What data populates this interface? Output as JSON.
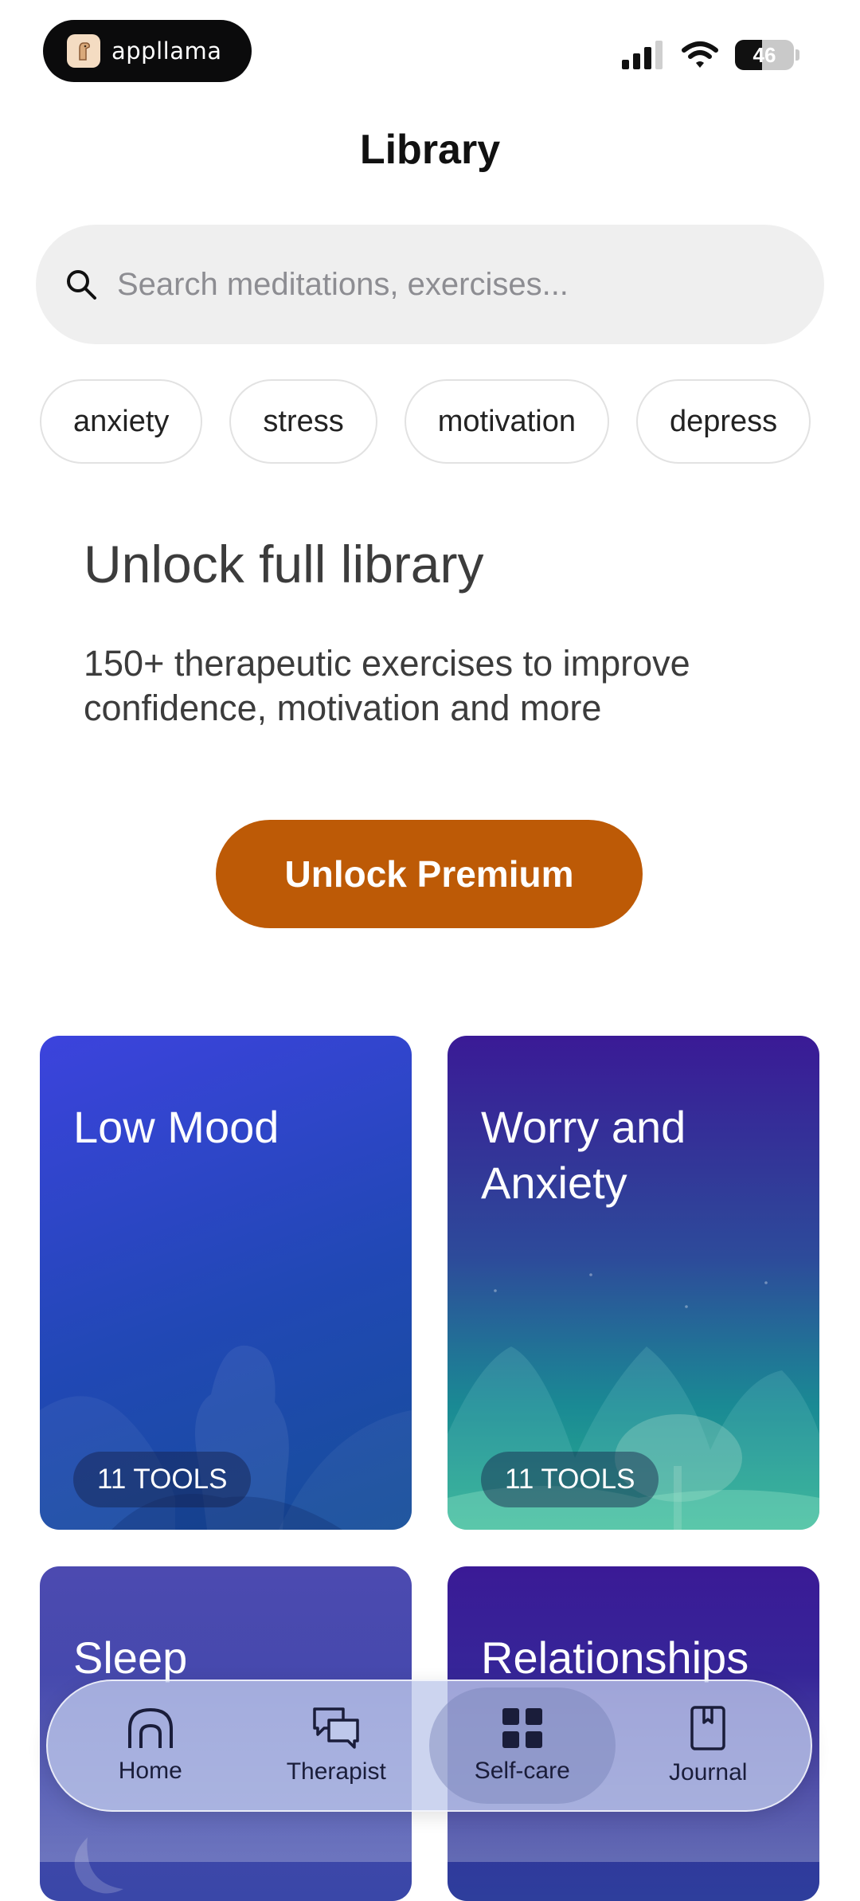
{
  "status_bar": {
    "brand": "appllama",
    "battery": "46"
  },
  "header": {
    "title": "Library"
  },
  "search": {
    "placeholder": "Search meditations, exercises..."
  },
  "chips": [
    "anxiety",
    "stress",
    "motivation",
    "depress"
  ],
  "unlock": {
    "title": "Unlock full library",
    "description": "150+ therapeutic exercises to improve confidence, motivation and more",
    "button": "Unlock Premium",
    "accent": "#bd5a06"
  },
  "cards": [
    {
      "title": "Low Mood",
      "badge": "11 TOOLS"
    },
    {
      "title": "Worry and Anxiety",
      "badge": "11 TOOLS"
    },
    {
      "title": "Sleep"
    },
    {
      "title": "Relationships"
    }
  ],
  "nav": {
    "items": [
      {
        "label": "Home",
        "icon": "home-arch-icon"
      },
      {
        "label": "Therapist",
        "icon": "chat-bubbles-icon"
      },
      {
        "label": "Self-care",
        "icon": "grid-icon",
        "active": true
      },
      {
        "label": "Journal",
        "icon": "book-icon"
      }
    ]
  }
}
